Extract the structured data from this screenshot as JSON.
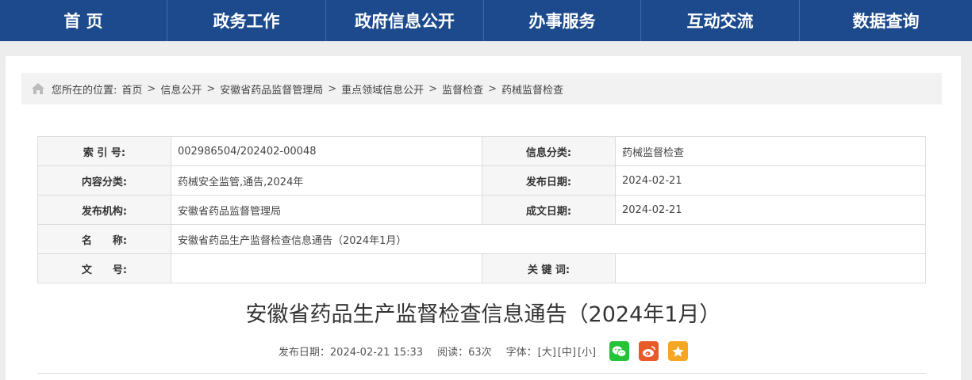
{
  "nav": {
    "items": [
      {
        "label": "首 页"
      },
      {
        "label": "政务工作"
      },
      {
        "label": "政府信息公开"
      },
      {
        "label": "办事服务"
      },
      {
        "label": "互动交流"
      },
      {
        "label": "数据查询"
      }
    ]
  },
  "breadcrumb": {
    "prefix": "您所在的位置:",
    "items": [
      "首页",
      "信息公开",
      "安徽省药品监督管理局",
      "重点领域信息公开",
      "监督检查",
      "药械监督检查"
    ],
    "separator": ">"
  },
  "info": {
    "index_label": "索 引 号:",
    "index_value": "002986504/202402-00048",
    "category_label": "信息分类:",
    "category_value": "药械监督检查",
    "content_label": "内容分类:",
    "content_value": "药械安全监管,通告,2024年",
    "pubdate_label": "发布日期:",
    "pubdate_value": "2024-02-21",
    "org_label": "发布机构:",
    "org_value": "安徽省药品监督管理局",
    "docdate_label": "成文日期:",
    "docdate_value": "2024-02-21",
    "name_label": "名　　称:",
    "name_value": "安徽省药品生产监督检查信息通告（2024年1月）",
    "docno_label": "文　　号:",
    "docno_value": "",
    "keyword_label": "关 键 词:",
    "keyword_value": ""
  },
  "article": {
    "title": "安徽省药品生产监督检查信息通告（2024年1月）",
    "published": "发布日期：2024-02-21 15:33",
    "reads": "阅读：63次",
    "font_label": "字体：",
    "font_large": "[大]",
    "font_medium": "[中]",
    "font_small": "[小]"
  },
  "share_icons": [
    "wechat-icon",
    "weibo-icon",
    "qzone-icon"
  ],
  "colors": {
    "nav_bg": "#1d4a8c",
    "wechat": "#25c337",
    "weibo": "#e85a2a",
    "qzone": "#f5a623"
  }
}
